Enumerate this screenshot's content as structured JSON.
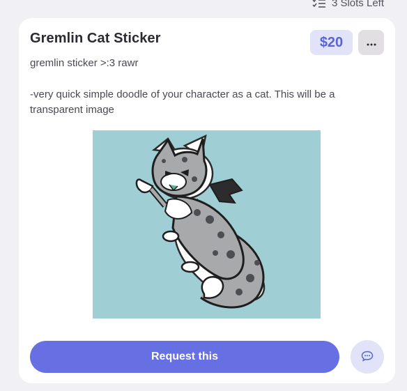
{
  "slots": {
    "icon": "checklist-icon",
    "label": "3 Slots Left"
  },
  "card": {
    "title": "Gremlin Cat Sticker",
    "price": "$20",
    "more_icon": "ellipsis-icon",
    "subtitle": "gremlin sticker >:3 rawr",
    "description": "-very quick simple doodle of your character as a cat. This will be a transparent image",
    "image": {
      "subject": "cartoon gray spotted cat sticker with bat wing on teal background"
    },
    "request_label": "Request this",
    "chat_icon": "chat-bubble-icon"
  },
  "colors": {
    "accent": "#6670e3",
    "price_bg": "#e1e3f8",
    "price_text": "#5a64d4",
    "art_bg": "#9fcfd5",
    "page_bg": "#f1f0f4"
  }
}
